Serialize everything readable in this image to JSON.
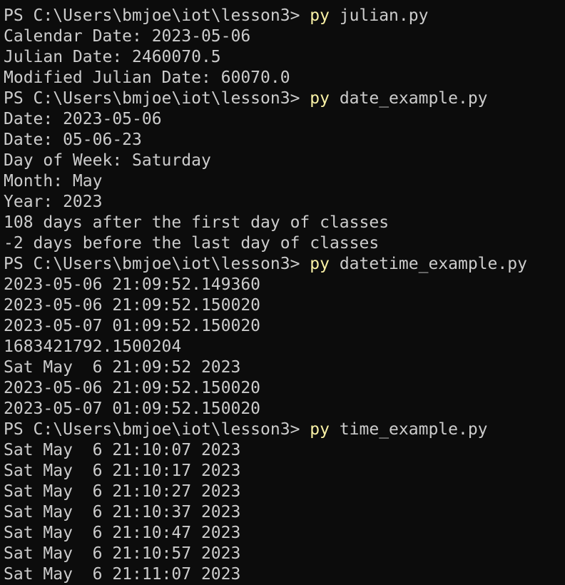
{
  "terminal": {
    "prompt": "PS C:\\Users\\bmjoe\\iot\\lesson3> ",
    "colors": {
      "background": "#0c0c0c",
      "foreground": "#cccccc",
      "command": "#f9f1a5"
    },
    "blocks": [
      {
        "command": {
          "program": "py",
          "args": " julian.py"
        },
        "output": [
          "Calendar Date: 2023-05-06",
          "Julian Date: 2460070.5",
          "Modified Julian Date: 60070.0"
        ]
      },
      {
        "command": {
          "program": "py",
          "args": " date_example.py"
        },
        "output": [
          "Date: 2023-05-06",
          "Date: 05-06-23",
          "Day of Week: Saturday",
          "Month: May",
          "Year: 2023",
          "108 days after the first day of classes",
          "-2 days before the last day of classes"
        ]
      },
      {
        "command": {
          "program": "py",
          "args": " datetime_example.py"
        },
        "output": [
          "2023-05-06 21:09:52.149360",
          "2023-05-06 21:09:52.150020",
          "2023-05-07 01:09:52.150020",
          "1683421792.1500204",
          "Sat May  6 21:09:52 2023",
          "2023-05-06 21:09:52.150020",
          "2023-05-07 01:09:52.150020"
        ]
      },
      {
        "command": {
          "program": "py",
          "args": " time_example.py"
        },
        "output": [
          "Sat May  6 21:10:07 2023",
          "Sat May  6 21:10:17 2023",
          "Sat May  6 21:10:27 2023",
          "Sat May  6 21:10:37 2023",
          "Sat May  6 21:10:47 2023",
          "Sat May  6 21:10:57 2023",
          "Sat May  6 21:11:07 2023"
        ]
      }
    ]
  }
}
